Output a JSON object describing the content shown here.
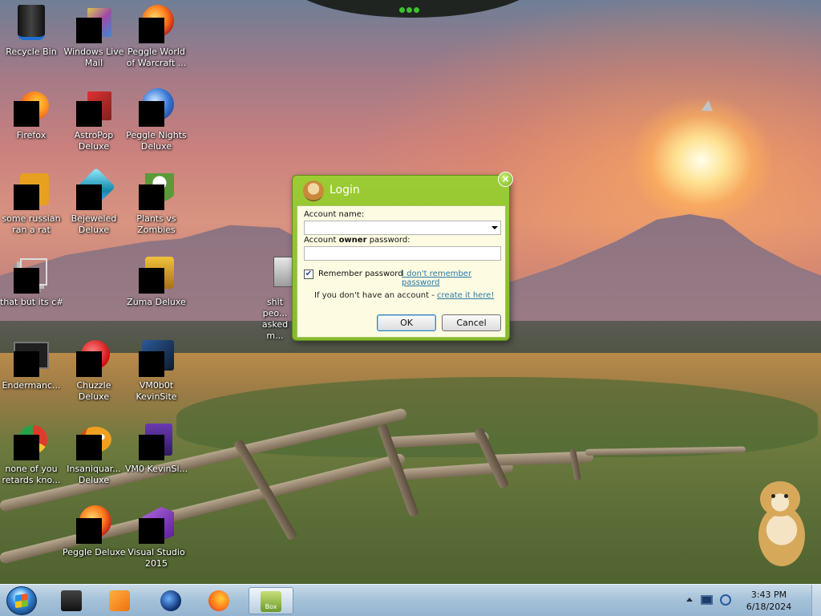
{
  "desktop": {
    "icons": [
      {
        "label": "Recycle Bin",
        "icon": "recycle-bin-icon"
      },
      {
        "label": "Windows Live Mail",
        "icon": "mail-icon"
      },
      {
        "label": "Peggle World of Warcraft ...",
        "icon": "peggle-icon"
      },
      {
        "label": "Firefox",
        "icon": "firefox-icon"
      },
      {
        "label": "AstroPop Deluxe",
        "icon": "astropop-icon"
      },
      {
        "label": "Peggle Nights Deluxe",
        "icon": "peggle-nights-icon"
      },
      {
        "label": "some russian ran a rat",
        "icon": "shortcut-icon"
      },
      {
        "label": "Bejeweled Deluxe",
        "icon": "bejeweled-icon"
      },
      {
        "label": "Plants vs Zombies",
        "icon": "plants-vs-zombies-icon"
      },
      {
        "label": "that but its c#",
        "icon": "stacked-windows-icon"
      },
      {
        "label": "Zuma Deluxe",
        "icon": "zuma-icon"
      },
      {
        "label": "shit peo... asked m...",
        "icon": "file-icon"
      },
      {
        "label": "Endermanc...",
        "icon": "terminal-icon"
      },
      {
        "label": "Chuzzle Deluxe",
        "icon": "chuzzle-icon"
      },
      {
        "label": "VM0b0t KevinSite",
        "icon": "vm-icon"
      },
      {
        "label": "none of you retards kno...",
        "icon": "chrome-icon"
      },
      {
        "label": "Insaniquar... Deluxe",
        "icon": "insaniquarium-icon"
      },
      {
        "label": "VM0 KevinSi...",
        "icon": "vm-icon"
      },
      {
        "label": "Peggle Deluxe",
        "icon": "peggle-icon"
      },
      {
        "label": "Visual Studio 2015",
        "icon": "visual-studio-icon"
      }
    ]
  },
  "login_dialog": {
    "title": "Login",
    "account_name_label": "Account name:",
    "account_name_value": "",
    "password_label_prefix": "Account ",
    "password_label_bold": "owner",
    "password_label_suffix": " password:",
    "password_value": "",
    "remember_label": "Remember password",
    "remember_checked": true,
    "forgot_link": "I don't remember password",
    "no_account_text": "If you don't have an account - ",
    "create_link": "create it here!",
    "ok_label": "OK",
    "cancel_label": "Cancel",
    "close_glyph": "×"
  },
  "taskbar": {
    "items": [
      {
        "name": "taskbar-app-terminal",
        "icon": "terminal-icon"
      },
      {
        "name": "taskbar-app-media-player",
        "icon": "media-player-icon"
      },
      {
        "name": "taskbar-app-browser",
        "icon": "globe-icon"
      },
      {
        "name": "taskbar-app-firefox",
        "icon": "firefox-icon"
      },
      {
        "name": "taskbar-app-box",
        "icon": "box-icon",
        "active": true
      }
    ],
    "active_item_caption": "Box",
    "clock": {
      "time": "3:43 PM",
      "date": "6/18/2024"
    }
  },
  "colors": {
    "dialog_green": "#8dc02c",
    "dialog_body": "#fdfbe2",
    "link_blue": "#2a7aa8"
  }
}
